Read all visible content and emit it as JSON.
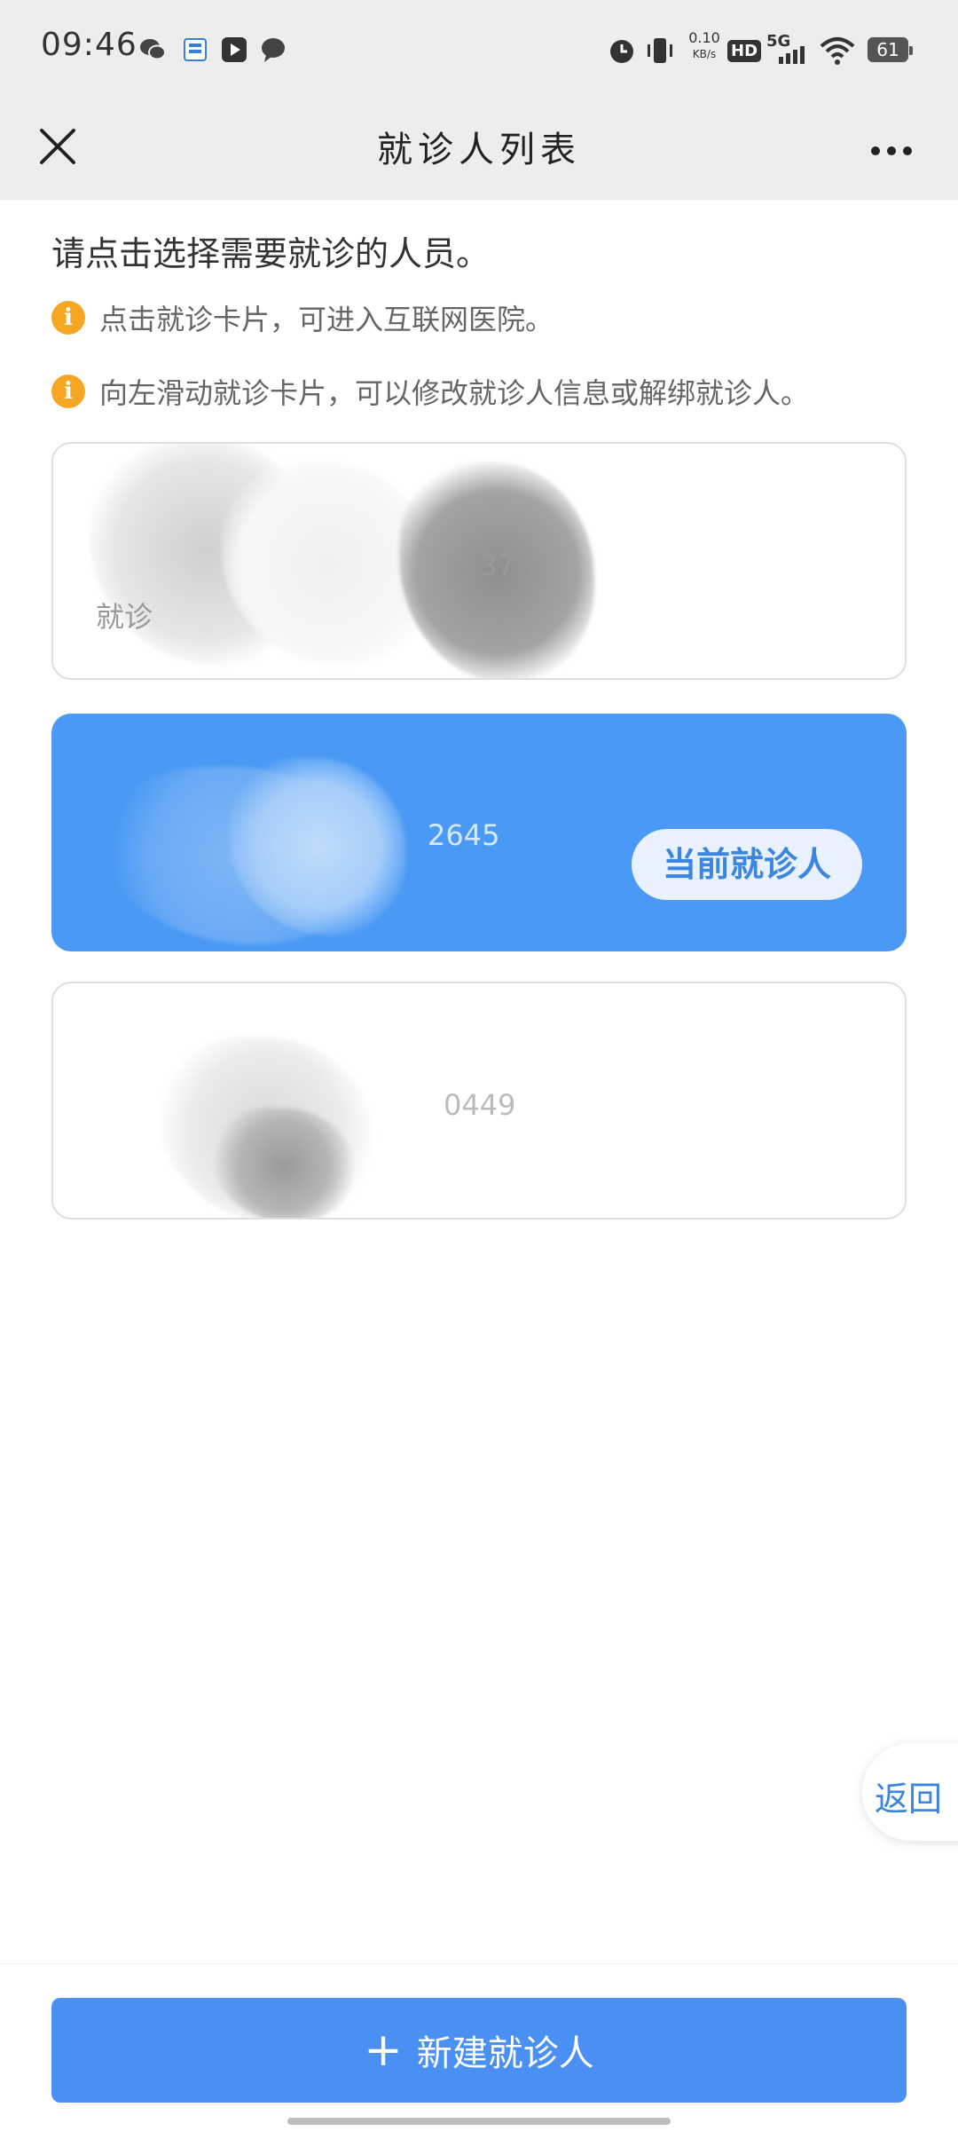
{
  "status_bar": {
    "time": "09:46",
    "net_speed_value": "0.10",
    "net_speed_unit": "KB/s",
    "hd_label": "HD",
    "network_label": "5G",
    "battery_level": "61"
  },
  "nav": {
    "title": "就诊人列表"
  },
  "instruction": "请点击选择需要就诊的人员。",
  "tips": [
    "点击就诊卡片，可进入互联网医院。",
    "向左滑动就诊卡片，可以修改就诊人信息或解绑就诊人。"
  ],
  "tip_icon_glyph": "i",
  "patients": [
    {
      "id_fragment": "37",
      "sub_label": "就诊",
      "selected": false
    },
    {
      "id_fragment": "2645",
      "sub_label": "",
      "selected": true,
      "badge": "当前就诊人"
    },
    {
      "id_fragment": "0449",
      "sub_label": "",
      "selected": false
    }
  ],
  "back_button": "返回",
  "new_patient_button": "新建就诊人",
  "colors": {
    "accent": "#4a90f3",
    "selected_card": "#4a9af5",
    "tip_icon": "#f5a623",
    "nav_bg": "#ededed"
  }
}
